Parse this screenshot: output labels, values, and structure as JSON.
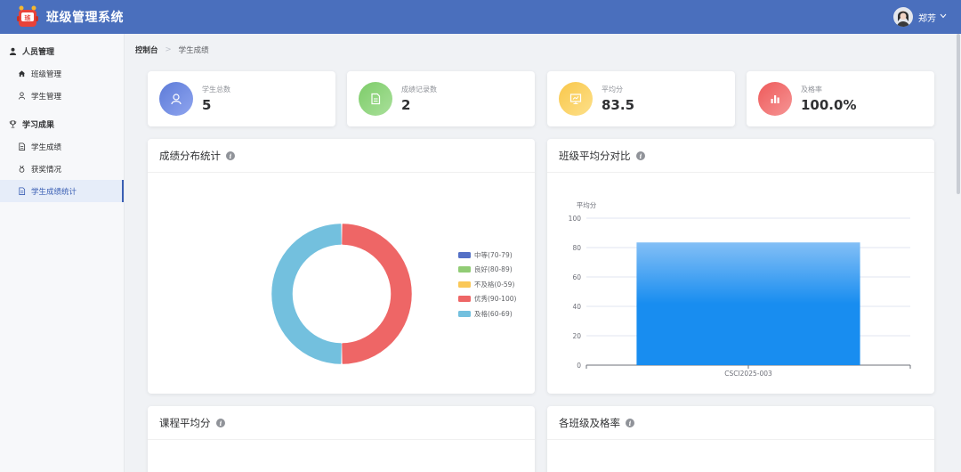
{
  "app": {
    "title": "班级管理系统",
    "user_name": "郑芳"
  },
  "sidebar": {
    "groups": [
      {
        "title": "人员管理",
        "items": [
          {
            "label": "班级管理"
          },
          {
            "label": "学生管理"
          }
        ]
      },
      {
        "title": "学习成果",
        "items": [
          {
            "label": "学生成绩"
          },
          {
            "label": "获奖情况"
          },
          {
            "label": "学生成绩统计"
          }
        ]
      }
    ],
    "active_item": "学生成绩统计"
  },
  "breadcrumb": {
    "home": "控制台",
    "current": "学生成绩"
  },
  "stats": [
    {
      "label": "学生总数",
      "value": "5",
      "icon": "user-icon",
      "color": "#6b86de"
    },
    {
      "label": "成绩记录数",
      "value": "2",
      "icon": "document-icon",
      "color": "#90d47d"
    },
    {
      "label": "平均分",
      "value": "83.5",
      "icon": "presentation-icon",
      "color": "#fcd25e"
    },
    {
      "label": "及格率",
      "value": "100.0%",
      "icon": "bar-chart-icon",
      "color": "#f06b6b"
    }
  ],
  "panels": {
    "grade_distribution": {
      "title": "成绩分布统计"
    },
    "class_average": {
      "title": "班级平均分对比"
    },
    "course_average": {
      "title": "课程平均分"
    },
    "class_pass_rate": {
      "title": "各班级及格率"
    }
  },
  "chart_data": [
    {
      "type": "pie",
      "donut": true,
      "legend_placement": "right",
      "categories": [
        "中等(70-79)",
        "良好(80-89)",
        "不及格(0-59)",
        "优秀(90-100)",
        "及格(60-69)"
      ],
      "values": [
        0,
        0,
        0,
        1,
        1
      ],
      "colors": [
        "#5470c6",
        "#91cc75",
        "#fac858",
        "#ee6666",
        "#73c0de"
      ]
    },
    {
      "type": "bar",
      "ylabel": "平均分",
      "categories": [
        "CSCI2025-003"
      ],
      "values": [
        83.5
      ],
      "ylim": [
        0,
        100
      ],
      "yticks": [
        0,
        20,
        40,
        60,
        80,
        100
      ],
      "grid": true,
      "bar_colors": [
        "#83bff6",
        "#188df0"
      ]
    }
  ]
}
